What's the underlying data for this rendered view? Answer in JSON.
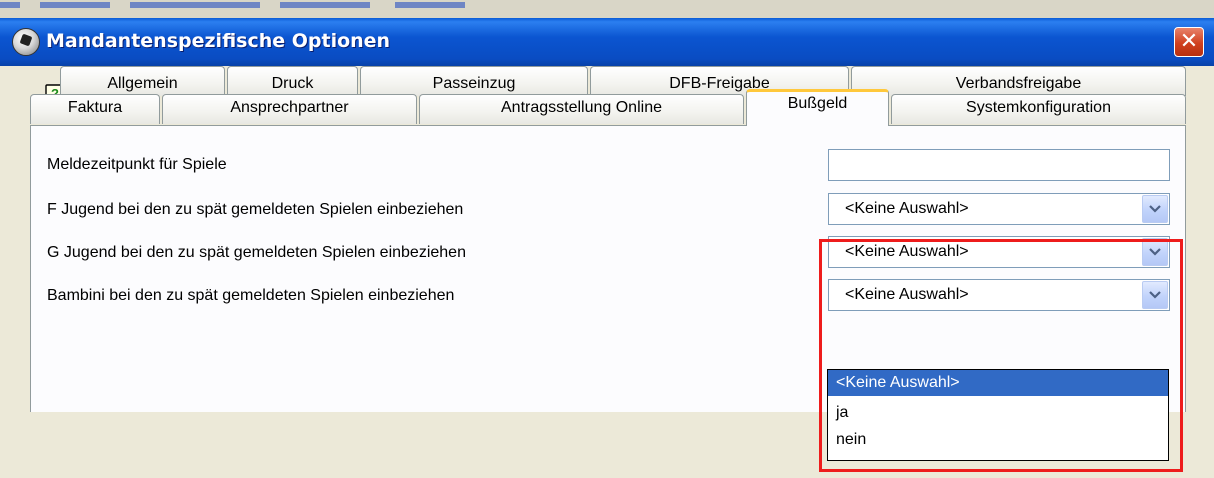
{
  "window": {
    "title": "Mandantenspezifische Optionen",
    "close_glyph": "✕"
  },
  "help": {
    "icon": "help-question-icon"
  },
  "tabs": {
    "row1": [
      "Allgemein",
      "Druck",
      "Passeinzug",
      "DFB-Freigabe",
      "Verbandsfreigabe"
    ],
    "row2": [
      "Faktura",
      "Ansprechpartner",
      "Antragsstellung Online",
      "Bußgeld",
      "Systemkonfiguration"
    ],
    "active": "Bußgeld"
  },
  "fields": [
    {
      "label": "Meldezeitpunkt für Spiele",
      "type": "text",
      "value": ""
    },
    {
      "label": "F Jugend bei den zu spät gemeldeten Spielen einbeziehen",
      "type": "combo",
      "value": "<Keine Auswahl>"
    },
    {
      "label": "G Jugend bei den zu spät gemeldeten Spielen einbeziehen",
      "type": "combo",
      "value": "<Keine Auswahl>"
    },
    {
      "label": "Bambini bei den zu spät gemeldeten Spielen einbeziehen",
      "type": "combo",
      "value": "<Keine Auswahl>"
    }
  ],
  "dropdown": {
    "options": [
      "<Keine Auswahl>",
      "ja",
      "nein"
    ],
    "selected_index": 0
  },
  "colors": {
    "titlebar": "#0a4cc2",
    "selection": "#316ac5",
    "highlight_box": "#ee1c1c",
    "active_tab_accent": "#ffc83c"
  }
}
